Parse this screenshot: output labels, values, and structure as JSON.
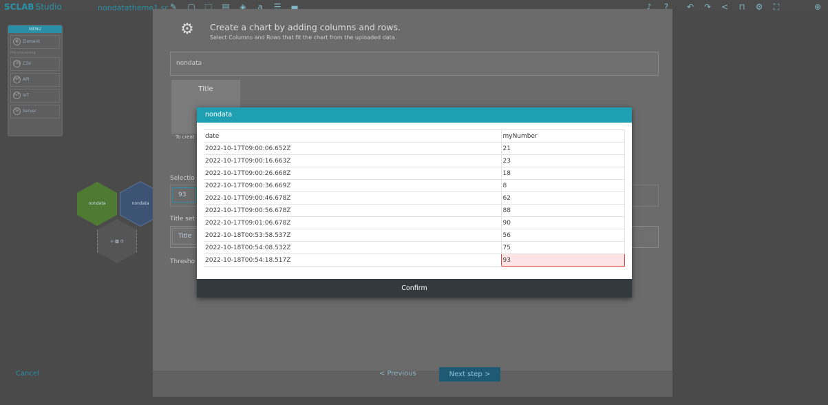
{
  "app": {
    "logo": "SCLAB",
    "studio": "Studio",
    "filename": "nondatatheme1.sc..."
  },
  "menu": {
    "header": "MENU",
    "element": "Element",
    "section": "Pre-processing",
    "items": [
      {
        "label": "CSV",
        "icon": "CSV"
      },
      {
        "label": "API",
        "icon": "API"
      },
      {
        "label": "IoT",
        "icon": "IoT"
      },
      {
        "label": "Server",
        "icon": "SV"
      }
    ]
  },
  "nodes": {
    "left": "nondata",
    "right": "nondata"
  },
  "wizard": {
    "title": "Create a chart by adding columns and rows.",
    "subtitle": "Select Columns and Rows that fit the chart from the uploaded data.",
    "dataset": "nondata",
    "preview_title": "Title",
    "to_create": "To creat",
    "selection_label": "Selectio",
    "selection_value": "93",
    "title_setting_label": "Title set",
    "title_value": "Title",
    "threshold_label": "Thresho",
    "cancel": "Cancel",
    "previous": "< Previous",
    "next": "Next step >"
  },
  "modal": {
    "title": "nondata",
    "columns": [
      "date",
      "myNumber"
    ],
    "rows": [
      [
        "2022-10-17T09:00:06.652Z",
        "21"
      ],
      [
        "2022-10-17T09:00:16.663Z",
        "23"
      ],
      [
        "2022-10-17T09:00:26.668Z",
        "18"
      ],
      [
        "2022-10-17T09:00:36.669Z",
        "8"
      ],
      [
        "2022-10-17T09:00:46.678Z",
        "62"
      ],
      [
        "2022-10-17T09:00:56.678Z",
        "88"
      ],
      [
        "2022-10-17T09:01:06.678Z",
        "90"
      ],
      [
        "2022-10-18T00:53:58.537Z",
        "56"
      ],
      [
        "2022-10-18T00:54:08.532Z",
        "75"
      ],
      [
        "2022-10-18T00:54:18.517Z",
        "93"
      ]
    ],
    "selected_value": "93",
    "confirm": "Confirm"
  }
}
